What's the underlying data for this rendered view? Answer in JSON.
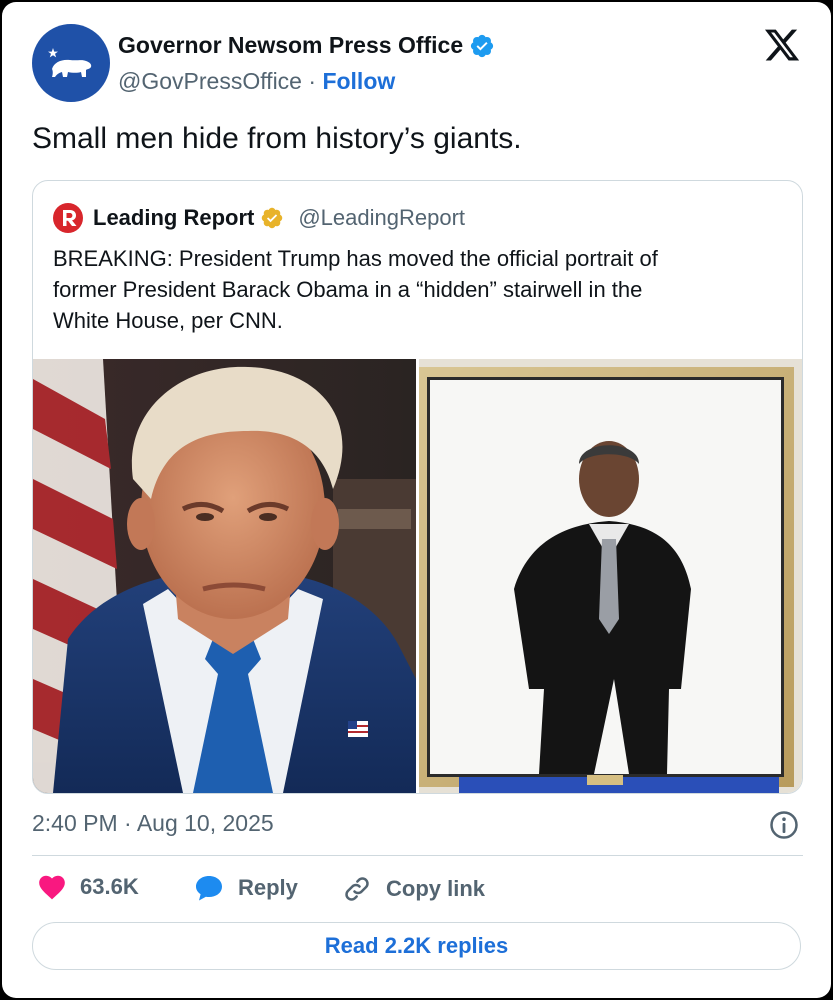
{
  "author": {
    "name": "Governor Newsom Press Office",
    "handle": "@GovPressOffice",
    "separator": "·",
    "follow_label": "Follow",
    "avatar_icon": "california-bear-icon",
    "verified_icon": "verified-badge-icon",
    "verified_color": "#1d9bf0"
  },
  "tweet": {
    "text": "Small men hide from history’s giants.",
    "timestamp": "2:40 PM · Aug 10, 2025"
  },
  "quoted": {
    "name": "Leading Report",
    "handle": "@LeadingReport",
    "verified_color": "#e8b32a",
    "logo_icon": "leading-report-logo-icon",
    "text_lines": [
      "BREAKING: President Trump has moved the official portrait of",
      "former President Barack Obama in a “hidden” stairwell in the",
      "White House, per CNN."
    ],
    "images": [
      "trump-portrait-photo",
      "obama-portrait-photo"
    ]
  },
  "actions": {
    "like_count": "63.6K",
    "reply_label": "Reply",
    "copy_label": "Copy link",
    "read_replies_label": "Read 2.2K replies"
  },
  "colors": {
    "accent": "#1d6fd8",
    "heart": "#f91880",
    "muted": "#536471",
    "border": "#cfd9de"
  }
}
